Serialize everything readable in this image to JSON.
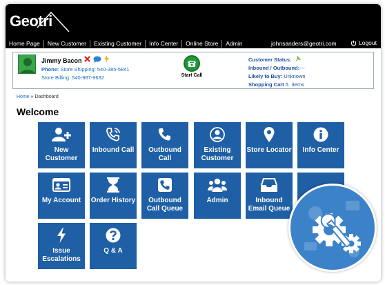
{
  "brand": {
    "name": "Geotri"
  },
  "nav": {
    "items": [
      "Home Page",
      "New Customer",
      "Existing Customer",
      "Info Center",
      "Online Store",
      "Admin"
    ],
    "email": "johnsanders@geotri.com",
    "logout": "Logout"
  },
  "customer": {
    "name": "Jimmy Bacon",
    "phone_label": "Phone:",
    "phone_value": "Store Shipping: 540-385-5841",
    "billing": "Store Billing: 540-987-9632",
    "start_call": "Start Call",
    "status_label": "Customer Status:",
    "inout_label": "Inbound / Outbound:",
    "inout_value": "---",
    "likely_label": "Likely to Buy:",
    "likely_value": "Unknown",
    "cart_label": "Shopping Cart",
    "cart_count": "5",
    "cart_unit": "items"
  },
  "breadcrumb": {
    "home": "Home",
    "sep": "»",
    "current": "Dashboard"
  },
  "page_title": "Welcome",
  "tiles": [
    {
      "label": "New Customer",
      "icon": "add-user-icon"
    },
    {
      "label": "Inbound Call",
      "icon": "phone-ringing-icon"
    },
    {
      "label": "Outbound Call",
      "icon": "phone-icon"
    },
    {
      "label": "Existing Customer",
      "icon": "user-circle-icon"
    },
    {
      "label": "Store Locator",
      "icon": "map-pin-icon"
    },
    {
      "label": "Info Center",
      "icon": "info-icon"
    },
    {
      "label": "My Account",
      "icon": "id-card-icon"
    },
    {
      "label": "Order History",
      "icon": "hourglass-icon"
    },
    {
      "label": "Outbound Call Queue",
      "icon": "phone-square-icon"
    },
    {
      "label": "Admin",
      "icon": "users-icon"
    },
    {
      "label": "Inbound Email Queue",
      "icon": "inbox-icon"
    },
    {
      "label": "Issue Escalations",
      "icon": "lightning-icon"
    },
    {
      "label": "Q & A",
      "icon": "question-icon"
    }
  ],
  "colors": {
    "tile": "#1f5fa5",
    "topbar": "#000000",
    "accent_green": "#1f9a3a",
    "badge": "#3b82c9"
  }
}
